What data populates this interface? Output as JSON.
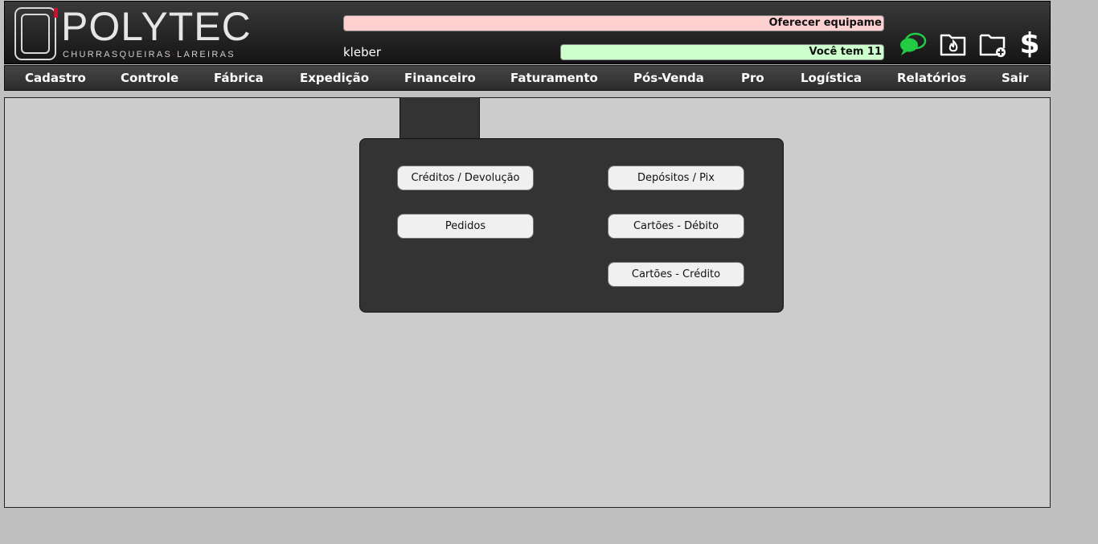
{
  "header": {
    "logo": {
      "name": "POLYTEC",
      "tagline_left": "CHURRASQUEIRAS",
      "tagline_right": "LAREIRAS"
    },
    "username": "kleber",
    "ticker_alert": "Oferecer equipame",
    "ticker_info": "Você tem 11",
    "icons": [
      "chat-icon",
      "folder-fire-icon",
      "folder-add-icon",
      "dollar-icon"
    ],
    "dollar_symbol": "$"
  },
  "nav": {
    "items": [
      {
        "label": "Cadastro"
      },
      {
        "label": "Controle"
      },
      {
        "label": "Fábrica"
      },
      {
        "label": "Expedição"
      },
      {
        "label": "Financeiro"
      },
      {
        "label": "Faturamento"
      },
      {
        "label": "Pós-Venda"
      },
      {
        "label": "Pro"
      },
      {
        "label": "Logística"
      },
      {
        "label": "Relatórios"
      },
      {
        "label": "Sair"
      }
    ]
  },
  "submenu": {
    "parent": "Financeiro",
    "buttons": {
      "creditos": "Créditos / Devolução",
      "pedidos": "Pedidos",
      "depositos": "Depósitos / Pix",
      "debito": "Cartões - Débito",
      "credito": "Cartões - Crédito"
    }
  },
  "colors": {
    "accent_red": "#c8102e",
    "ticker_alert_bg": "#ffd0d0",
    "ticker_info_bg": "#ccffcc",
    "chat_green": "#22cc44",
    "content_bg": "#cccccc",
    "panel_bg": "#333333"
  }
}
